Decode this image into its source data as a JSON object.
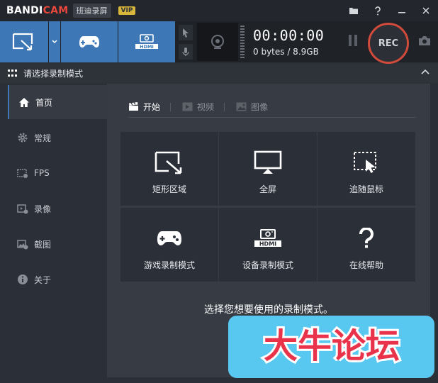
{
  "app": {
    "logo_part1": "BANDI",
    "logo_part2": "CAM",
    "cn_name": "班迪录屏",
    "vip": "VIP"
  },
  "titlebar_icons": [
    "folder-icon",
    "help-icon",
    "minimize-icon",
    "close-icon"
  ],
  "toolbar": {
    "modes": [
      "rectangle-area-mode",
      "game-mode",
      "device-mode"
    ],
    "hdmi_label": "HDMI",
    "timer": "00:00:00",
    "size": "0 bytes / 8.9GB",
    "rec_label": "REC"
  },
  "section": {
    "title": "请选择录制模式"
  },
  "sidebar": {
    "items": [
      {
        "label": "首页",
        "icon": "home-icon",
        "active": true
      },
      {
        "label": "常规",
        "icon": "gear-icon"
      },
      {
        "label": "FPS",
        "icon": "fps-icon"
      },
      {
        "label": "录像",
        "icon": "video-settings-icon"
      },
      {
        "label": "截图",
        "icon": "image-settings-icon"
      },
      {
        "label": "关于",
        "icon": "info-icon"
      }
    ]
  },
  "tabs": [
    {
      "label": "开始",
      "icon": "clapper-icon",
      "active": true
    },
    {
      "label": "视频",
      "icon": "play-icon"
    },
    {
      "label": "图像",
      "icon": "image-icon"
    }
  ],
  "tiles": [
    {
      "label": "矩形区域",
      "icon": "rectangle-area-icon"
    },
    {
      "label": "全屏",
      "icon": "monitor-icon"
    },
    {
      "label": "追随鼠标",
      "icon": "follow-mouse-icon"
    },
    {
      "label": "游戏录制模式",
      "icon": "gamepad-icon"
    },
    {
      "label": "设备录制模式",
      "icon": "hdmi-icon"
    },
    {
      "label": "在线帮助",
      "icon": "question-icon"
    }
  ],
  "hint": "选择您想要使用的录制模式。",
  "watermark": "大牛论坛",
  "colors": {
    "accent_blue": "#3d77b5",
    "rec_red": "#d14b3b",
    "logo_red": "#e9463c",
    "watermark_bg": "#58c8f1",
    "watermark_text": "#e8334a"
  }
}
